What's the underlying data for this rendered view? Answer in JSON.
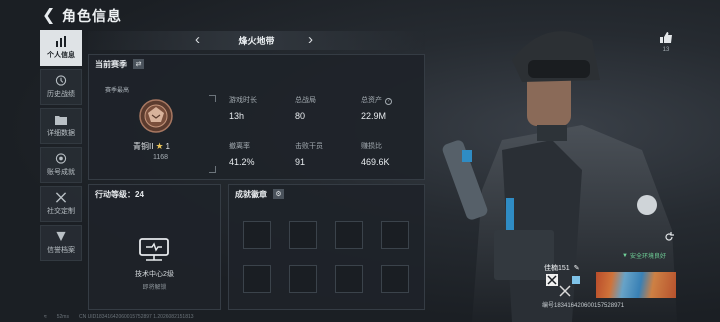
{
  "header": {
    "title": "角色信息"
  },
  "sidebar": {
    "items": [
      {
        "label": "个人信息",
        "icon": "bar-chart-icon",
        "active": true
      },
      {
        "label": "历史战绩",
        "icon": "history-icon"
      },
      {
        "label": "详细数据",
        "icon": "folder-icon"
      },
      {
        "label": "账号成就",
        "icon": "trophy-icon"
      },
      {
        "label": "社交定制",
        "icon": "tools-icon"
      },
      {
        "label": "信誉档案",
        "icon": "shield-icon"
      }
    ]
  },
  "mode": {
    "name": "烽火地带"
  },
  "season": {
    "title": "当前赛季",
    "rank_label": "赛季最高",
    "rank_name": "青铜II",
    "rank_stars": "1",
    "rank_score": "1168",
    "stats": [
      {
        "key": "游戏时长",
        "value": "13h"
      },
      {
        "key": "总战局",
        "value": "80"
      },
      {
        "key": "总资产",
        "value": "22.9M"
      },
      {
        "key": "撤离率",
        "value": "41.2%"
      },
      {
        "key": "击败干员",
        "value": "91"
      },
      {
        "key": "赚损比",
        "value": "469.6K"
      }
    ]
  },
  "level": {
    "title": "行动等级：24",
    "center_name": "技术中心2级",
    "center_sub": "即将解锁"
  },
  "badges": {
    "title": "成就徽章"
  },
  "likes": {
    "count": "13"
  },
  "safety": {
    "text": "安全环境良好"
  },
  "namecard": {
    "name": "佳楠151",
    "id": "编号183416420600157528971"
  },
  "footer": {
    "ping": "52ms",
    "uid": "CN UID18341642060015752897 1.2026082151813"
  },
  "colors": {
    "accent_green": "#71d39a",
    "star": "#e7c25a"
  }
}
